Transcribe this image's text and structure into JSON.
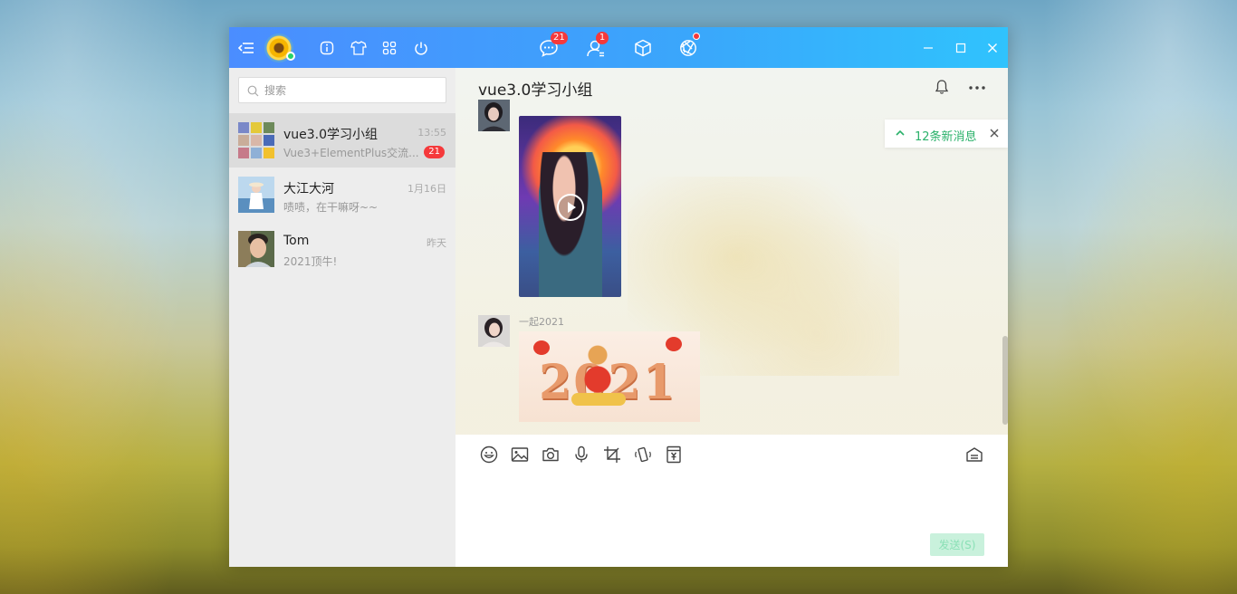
{
  "titlebar": {
    "msg_badge": "21",
    "contact_badge": "1",
    "icons": [
      "menu-icon",
      "info-icon",
      "shirt-icon",
      "apps-icon",
      "power-icon",
      "chat-icon",
      "contacts-icon",
      "cube-icon",
      "aperture-icon",
      "minimize-icon",
      "maximize-icon",
      "close-icon"
    ]
  },
  "search": {
    "placeholder": "搜索"
  },
  "chats": [
    {
      "name": "vue3.0学习小组",
      "time": "13:55",
      "preview": "Vue3+ElementPlus交流...",
      "badge": "21"
    },
    {
      "name": "大江大河",
      "time": "1月16日",
      "preview": "啧啧，在干嘛呀~~"
    },
    {
      "name": "Tom",
      "time": "昨天",
      "preview": "2021顶牛!"
    }
  ],
  "conversation": {
    "title": "vue3.0学习小组",
    "new_messages": "12条新消息",
    "messages": [
      {
        "sender": "",
        "type": "video"
      },
      {
        "sender": "一起2021",
        "type": "image",
        "image_text": "2021"
      }
    ]
  },
  "compose": {
    "send_label": "发送(S)"
  },
  "colors": {
    "accent": "#3aa7fb",
    "badge": "#f5393b",
    "green": "#2ab16a"
  }
}
